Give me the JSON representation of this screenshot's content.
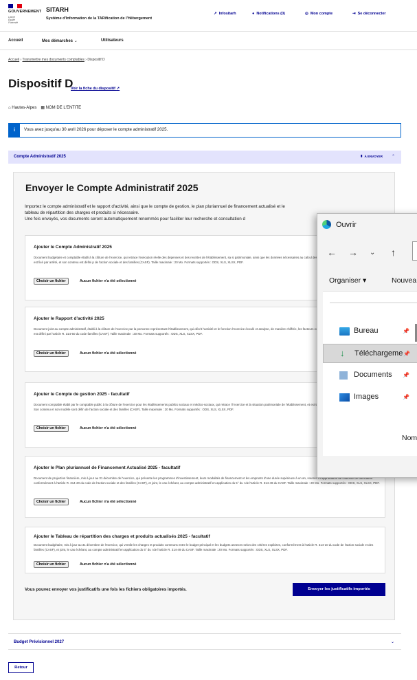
{
  "header": {
    "gov_line1": "GOUVERNEMENT",
    "motto": "Liberté Égalité Fraternité",
    "app_title": "SITARH",
    "app_subtitle": "Système d'Information de la TARification de l'Hébergement",
    "links": [
      "Infositarh",
      "Notifications (0)",
      "Mon compte",
      "Se déconnecter"
    ]
  },
  "nav": {
    "items": [
      "Accueil",
      "Mes démarches",
      "Utilisateurs"
    ]
  },
  "breadcrumb": {
    "items": [
      "Accueil",
      "Transmettre mes documents comptables",
      "Dispositif D"
    ]
  },
  "page": {
    "title": "Dispositif D",
    "fiche_link": "Voir la fiche du dispositif",
    "location": "Hautes-Alpes",
    "entity": "NOM DE L'ENTITE"
  },
  "alert": {
    "icon": "i",
    "text": "Vous avez jusqu'au 30 avril 2026 pour déposer le compte administratif 2025."
  },
  "accordion1": {
    "title": "Compte Administratif 2025",
    "badge": "À ENVOYER"
  },
  "main": {
    "title": "Envoyer le Compte Administratif 2025",
    "intro_line1": "Importez le compte administratif et le rapport d'activité, ainsi que le compte de gestion, le plan pluriannuel de financement actualisé et le",
    "intro_line2": "tableau de répartition des charges et produits si nécessaire.",
    "intro_line3": "Une fois envoyés, vos documents seront automatiquement renommés pour faciliter leur recherche et consultation d"
  },
  "documents": [
    {
      "title": "Ajouter le Compte Administratif 2025",
      "desc": "Document budgétaire et comptable établi à la clôture de l'exercice, qui retrace l'exécution réelle des dépenses et des recettes de l'établissement, sa si patrimoniale, ainsi que les données nécessaires au calcul des indicateurs de pilotage. Son cadre normalisé est fixé par arrêté, et son contenu est défini p de l'action sociale et des familles (CASF). Taille maximale : 20 Mo. Formats supportés : ODS, XLS, XLSX, PDF.",
      "button": "Choisir un fichier",
      "status": "Aucun fichier n'a été sélectionné"
    },
    {
      "title": "Ajouter le Rapport d'activité 2025",
      "desc": "Document joint au compte administratif, établi à la clôture de l'exercice par la personne représentant l'établissement, qui décrit l'activité et le fonction l'exercice écoulé et analyse, de manière chiffrée, les facteurs expliquant le résultat d'exploitation. Son contenu est défini par l'article R. 314-50 du code familles (CASF). Taille maximale : 20 Mo. Formats supportés : ODS, XLS, XLSX, PDF.",
      "button": "Choisir un fichier",
      "status": "Aucun fichier n'a été sélectionné"
    },
    {
      "title": "Ajouter le Compte de gestion 2025 - facultatif",
      "desc": "Document comptable établi par le comptable public à la clôture de l'exercice pour les établissements publics sociaux et médico-sociaux, qui retrace l l'exercice et la situation patrimoniale de l'établissement, et est transmis conjointement au compte administratif. Son contenu et son modèle sont défin de l'action sociale et des familles (CASF). Taille maximale : 20 Mo. Formats supportés : ODS, XLS, XLSX, PDF.",
      "button": "Choisir un fichier",
      "status": "Aucun fichier n'a été sélectionné"
    },
    {
      "title": "Ajouter le Plan pluriannuel de Financement Actualisé 2025 - facultatif",
      "desc": "Document de projection financière, mis à jour au 31 décembre de l'exercice, qui présente les programmes d'investissement, leurs modalités de financement et les emprunts d'une durée supérieure à un an, soumis à l'approbation de l'autorité de tarification conformément à l'article R. 314-20 du code de l'action sociale et des familles (CASF), et joint, le cas échéant, au compte administratif en application du 5° du I de l'article R. 314-49 du CASF. Taille maximale : 20 Mo. Formats supportés : ODS, XLS, XLSX, PDF.",
      "button": "Choisir un fichier",
      "status": "Aucun fichier n'a été sélectionné"
    },
    {
      "title": "Ajouter le Tableau de répartition des charges et produits actualisés 2025 - facultatif",
      "desc": "Document budgétaire, mis à jour au 31 décembre de l'exercice, qui ventile les charges et produits communs entre le budget principal et les budgets annexes selon des critères explicites, conformément à l'article R. 314-10 du code de l'action sociale et des familles (CASF), et joint, le cas échéant, au compte administratif en application du 5° du I de l'article R. 314-49 du CASF. Taille maximale : 20 Mo. Formats supportés : ODS, XLS, XLSX, PDF.",
      "button": "Choisir un fichier",
      "status": "Aucun fichier n'a été sélectionné"
    }
  ],
  "footer": {
    "text": "Vous pouvez envoyer vos justificatifs une fois les fichiers obligatoires importés.",
    "send_button": "Envoyer les justificatifs importés"
  },
  "accordion2": {
    "title": "Budget Prévisionnel 2027"
  },
  "retour": "Retour",
  "dialog": {
    "title": "Ouvrir",
    "organiser": "Organiser ▾",
    "new_folder": "Nouvea",
    "items": [
      "Bureau",
      "Téléchargeme",
      "Documents",
      "Images"
    ],
    "nom": "Nom"
  }
}
